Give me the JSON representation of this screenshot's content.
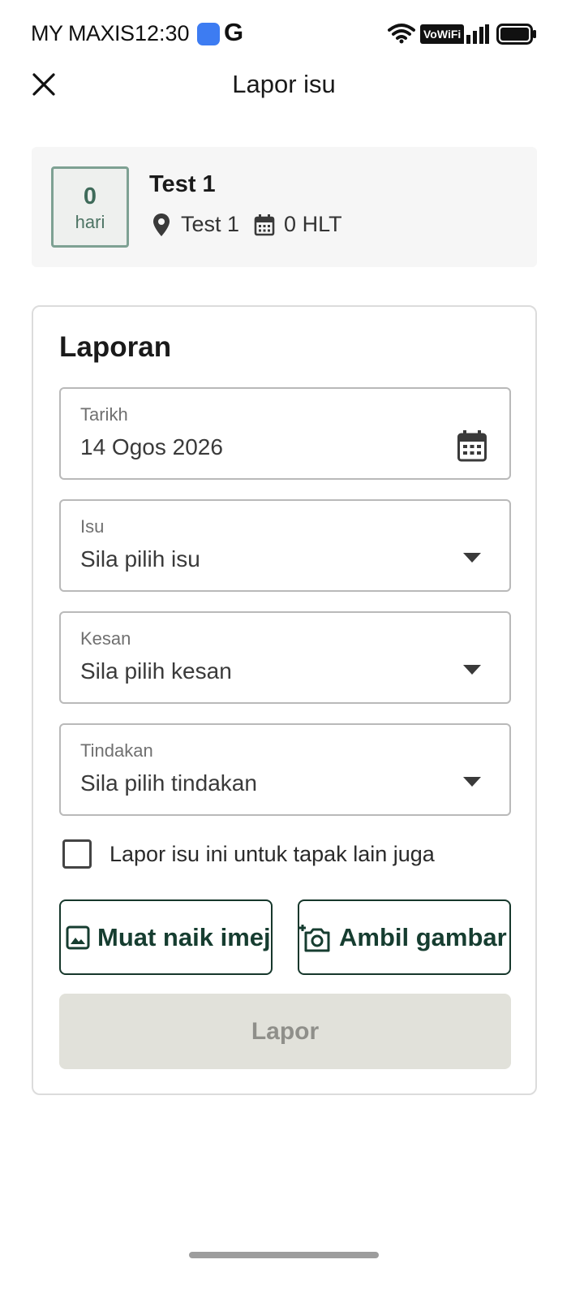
{
  "status_bar": {
    "carrier": "MY MAXIS",
    "time": "12:30",
    "g_label": "G",
    "vowifi_label": "VoWiFi",
    "icons": [
      "app-badge-icon",
      "google-icon",
      "wifi-icon",
      "vowifi-icon",
      "signal-icon",
      "battery-icon"
    ]
  },
  "header": {
    "title": "Lapor isu",
    "close_icon": "close-icon"
  },
  "summary": {
    "day_count": "0",
    "day_unit": "hari",
    "site_name": "Test 1",
    "location": "Test 1",
    "location_icon": "location-pin-icon",
    "duration": "0 HLT",
    "duration_icon": "calendar-icon"
  },
  "report": {
    "title": "Laporan",
    "date_field": {
      "label": "Tarikh",
      "value": "14 Ogos 2026",
      "icon": "calendar-icon"
    },
    "issue_field": {
      "label": "Isu",
      "placeholder": "Sila pilih isu",
      "icon": "dropdown-arrow-icon"
    },
    "impact_field": {
      "label": "Kesan",
      "placeholder": "Sila pilih kesan",
      "icon": "dropdown-arrow-icon"
    },
    "action_field": {
      "label": "Tindakan",
      "placeholder": "Sila pilih tindakan",
      "icon": "dropdown-arrow-icon"
    },
    "other_sites_checkbox": {
      "label": "Lapor isu ini untuk tapak lain juga",
      "checked": false
    },
    "upload_button": {
      "label": "Muat naik imej",
      "icon": "image-icon"
    },
    "camera_button": {
      "label": "Ambil gambar",
      "icon": "add-camera-icon"
    },
    "submit_button": {
      "label": "Lapor",
      "enabled": false
    }
  },
  "colors": {
    "accent_dark_green": "#163d30",
    "day_box_border": "#7ea193",
    "disabled_button_bg": "#e1e1da",
    "disabled_button_text": "#8f8f8a"
  }
}
